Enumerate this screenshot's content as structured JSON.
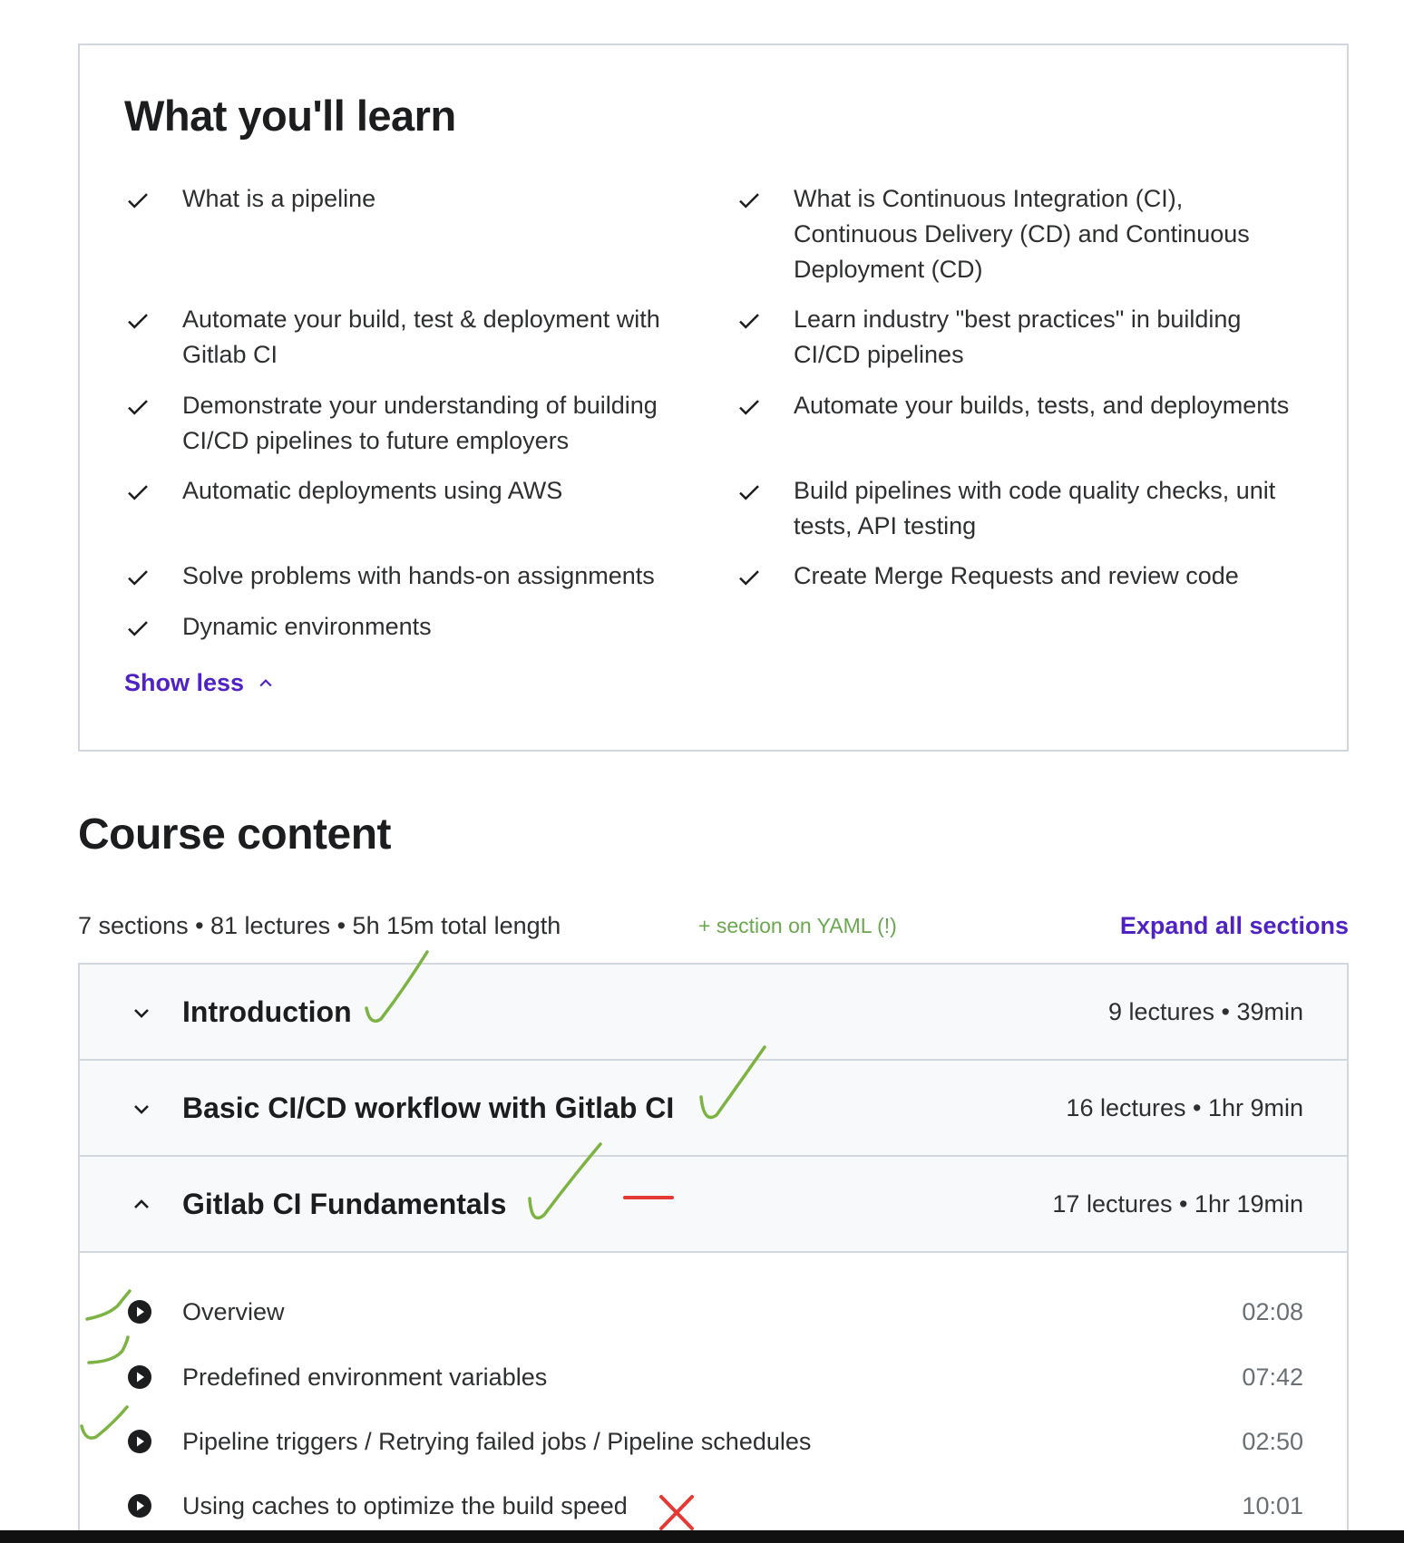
{
  "learn": {
    "title": "What you'll learn",
    "left": [
      "What is a pipeline",
      "Automate your build, test & deployment with Gitlab CI",
      "Demonstrate your understanding of building CI/CD pipelines to future employers",
      "Automatic deployments using AWS",
      "Solve problems with hands-on assignments",
      "Dynamic environments"
    ],
    "right": [
      "What is Continuous Integration (CI), Continuous Delivery (CD) and Continuous Deployment (CD)",
      "Learn industry \"best practices\" in building CI/CD pipelines",
      "Automate your builds, tests, and deployments",
      "Build pipelines with code quality checks, unit tests, API testing",
      "Create Merge Requests and review code"
    ],
    "show_less": "Show less"
  },
  "course": {
    "title": "Course content",
    "meta": "7 sections • 81 lectures • 5h 15m total length",
    "annotation": "+ section on YAML (!)",
    "expand_all": "Expand all sections",
    "sections": [
      {
        "title": "Introduction",
        "meta": "9 lectures • 39min",
        "expanded": false
      },
      {
        "title": "Basic CI/CD workflow with Gitlab CI",
        "meta": "16 lectures • 1hr 9min",
        "expanded": false
      },
      {
        "title": "Gitlab CI Fundamentals",
        "meta": "17 lectures • 1hr 19min",
        "expanded": true
      }
    ],
    "lectures": [
      {
        "title": "Overview",
        "time": "02:08"
      },
      {
        "title": "Predefined environment variables",
        "time": "07:42"
      },
      {
        "title": "Pipeline triggers / Retrying failed jobs / Pipeline schedules",
        "time": "02:50"
      },
      {
        "title": "Using caches to optimize the build speed",
        "time": "10:01"
      }
    ]
  },
  "colors": {
    "accent": "#5022c3",
    "annotation_green": "#7cb342",
    "annotation_red": "#e53935"
  }
}
